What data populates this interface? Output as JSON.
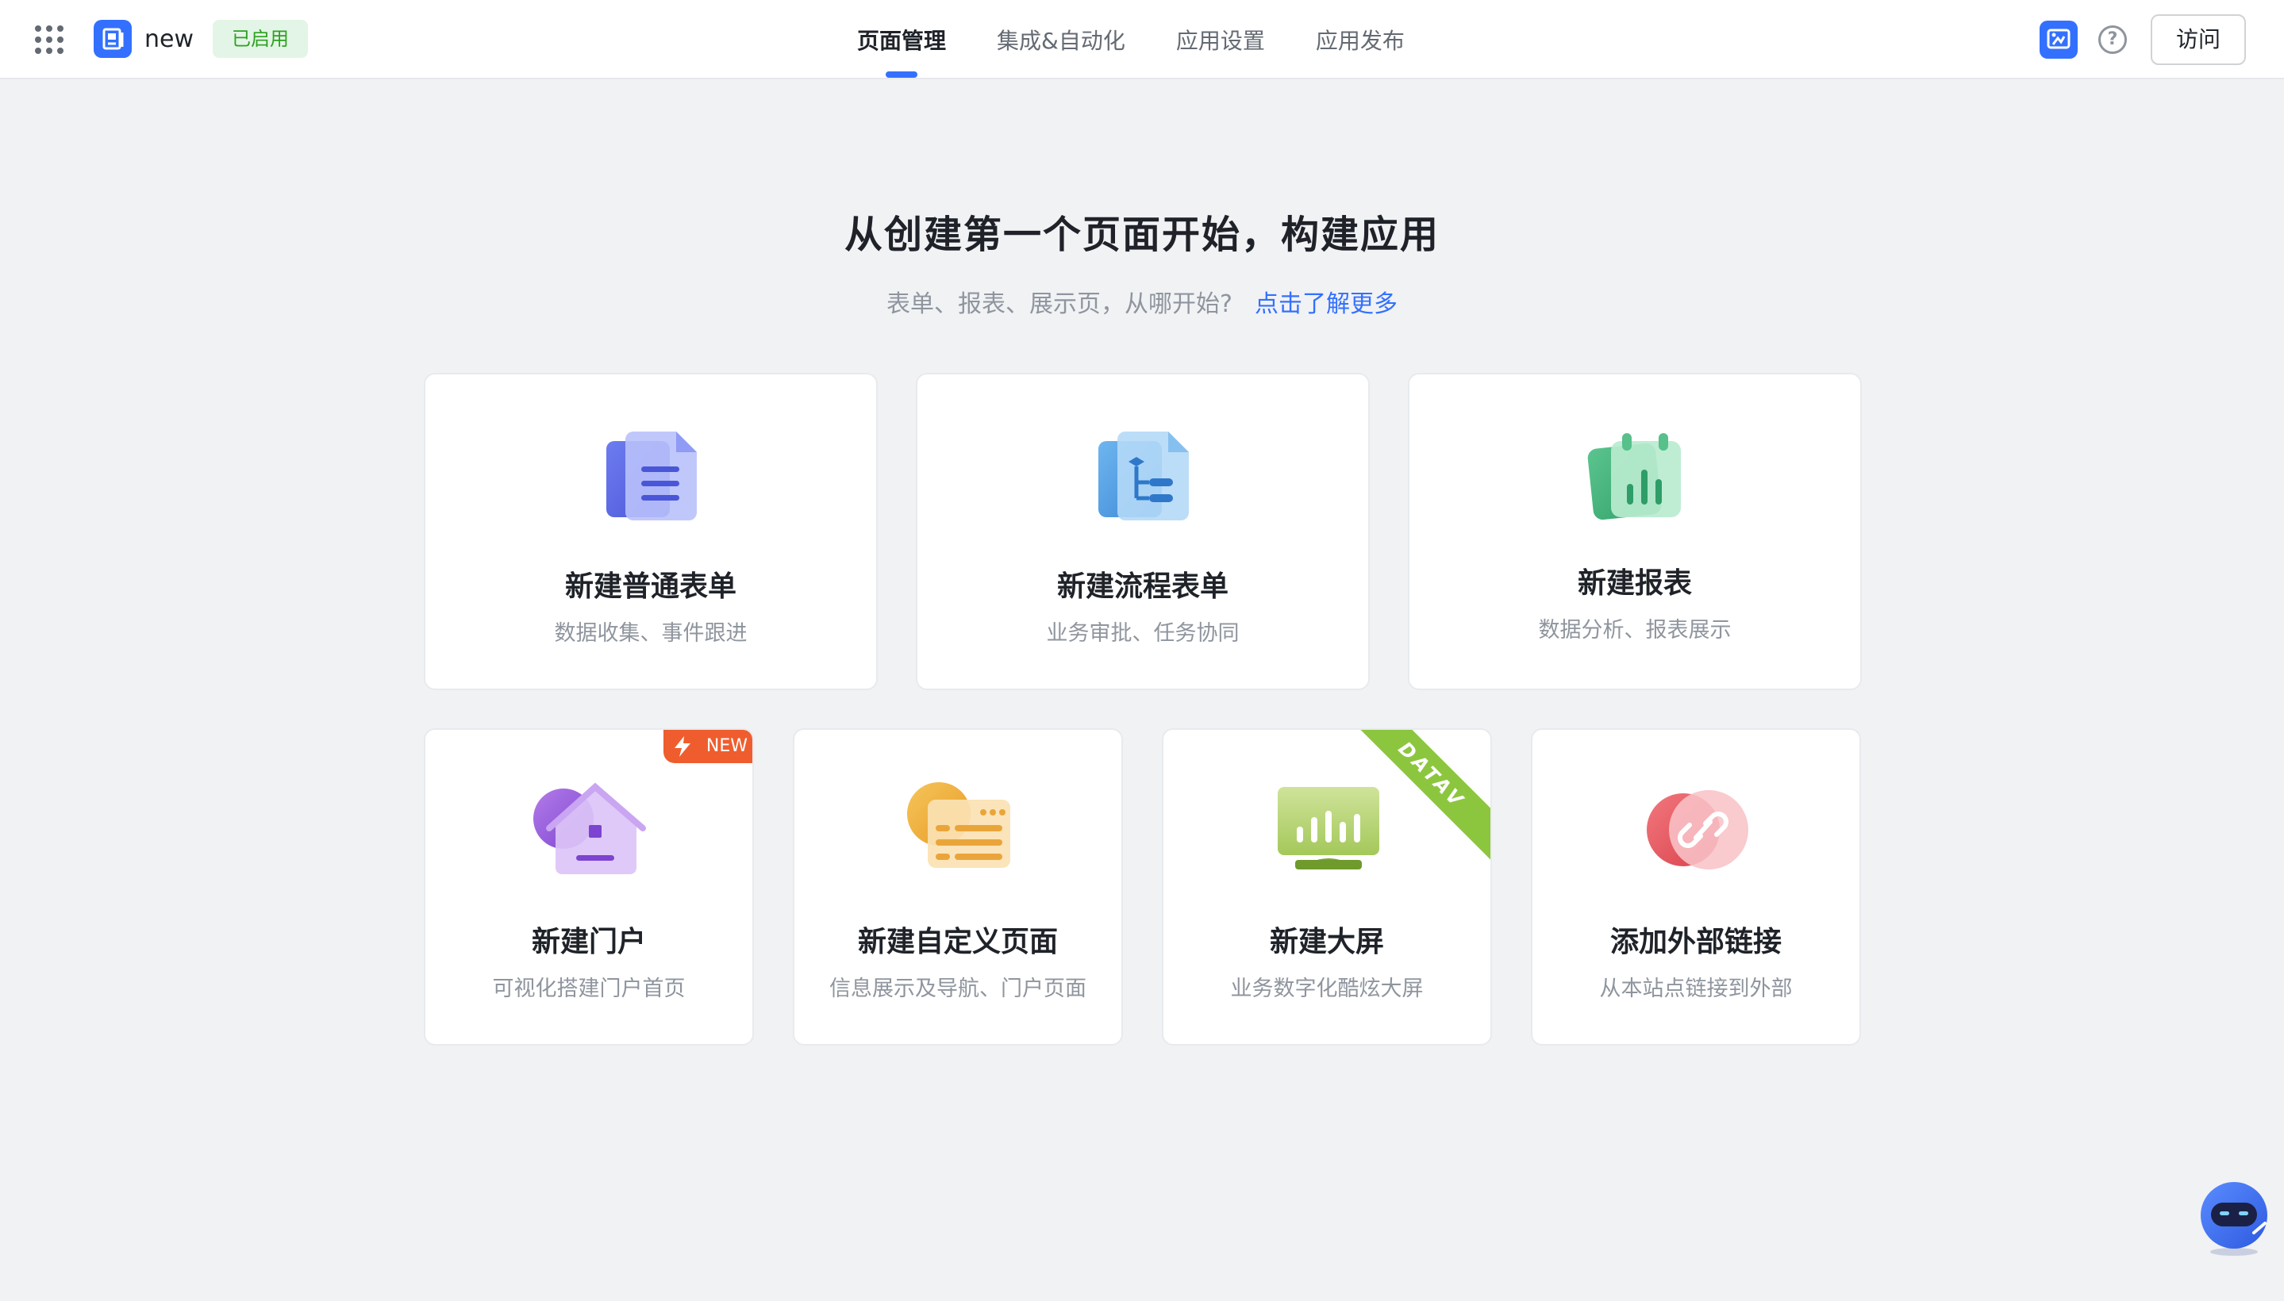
{
  "header": {
    "app_name": "new",
    "status": "已启用",
    "tabs": [
      {
        "label": "页面管理",
        "active": true
      },
      {
        "label": "集成&自动化",
        "active": false
      },
      {
        "label": "应用设置",
        "active": false
      },
      {
        "label": "应用发布",
        "active": false
      }
    ],
    "help_symbol": "?",
    "visit_label": "访问"
  },
  "hero": {
    "title": "从创建第一个页面开始，构建应用",
    "subtitle": "表单、报表、展示页，从哪开始?",
    "learn_more": "点击了解更多"
  },
  "cards": [
    {
      "title": "新建普通表单",
      "desc": "数据收集、事件跟进",
      "icon": "form-icon"
    },
    {
      "title": "新建流程表单",
      "desc": "业务审批、任务协同",
      "icon": "workflow-form-icon"
    },
    {
      "title": "新建报表",
      "desc": "数据分析、报表展示",
      "icon": "report-icon"
    },
    {
      "title": "新建门户",
      "desc": "可视化搭建门户首页",
      "icon": "portal-icon",
      "badge": "NEW"
    },
    {
      "title": "新建自定义页面",
      "desc": "信息展示及导航、门户页面",
      "icon": "custom-page-icon"
    },
    {
      "title": "新建大屏",
      "desc": "业务数字化酷炫大屏",
      "icon": "dashboard-screen-icon",
      "ribbon": "DATAV"
    },
    {
      "title": "添加外部链接",
      "desc": "从本站点链接到外部",
      "icon": "external-link-icon"
    }
  ],
  "colors": {
    "accent": "#3370ff",
    "status_green": "#2ea121",
    "new_badge": "#ef5d2e",
    "datav_ribbon": "#8cc63f"
  }
}
